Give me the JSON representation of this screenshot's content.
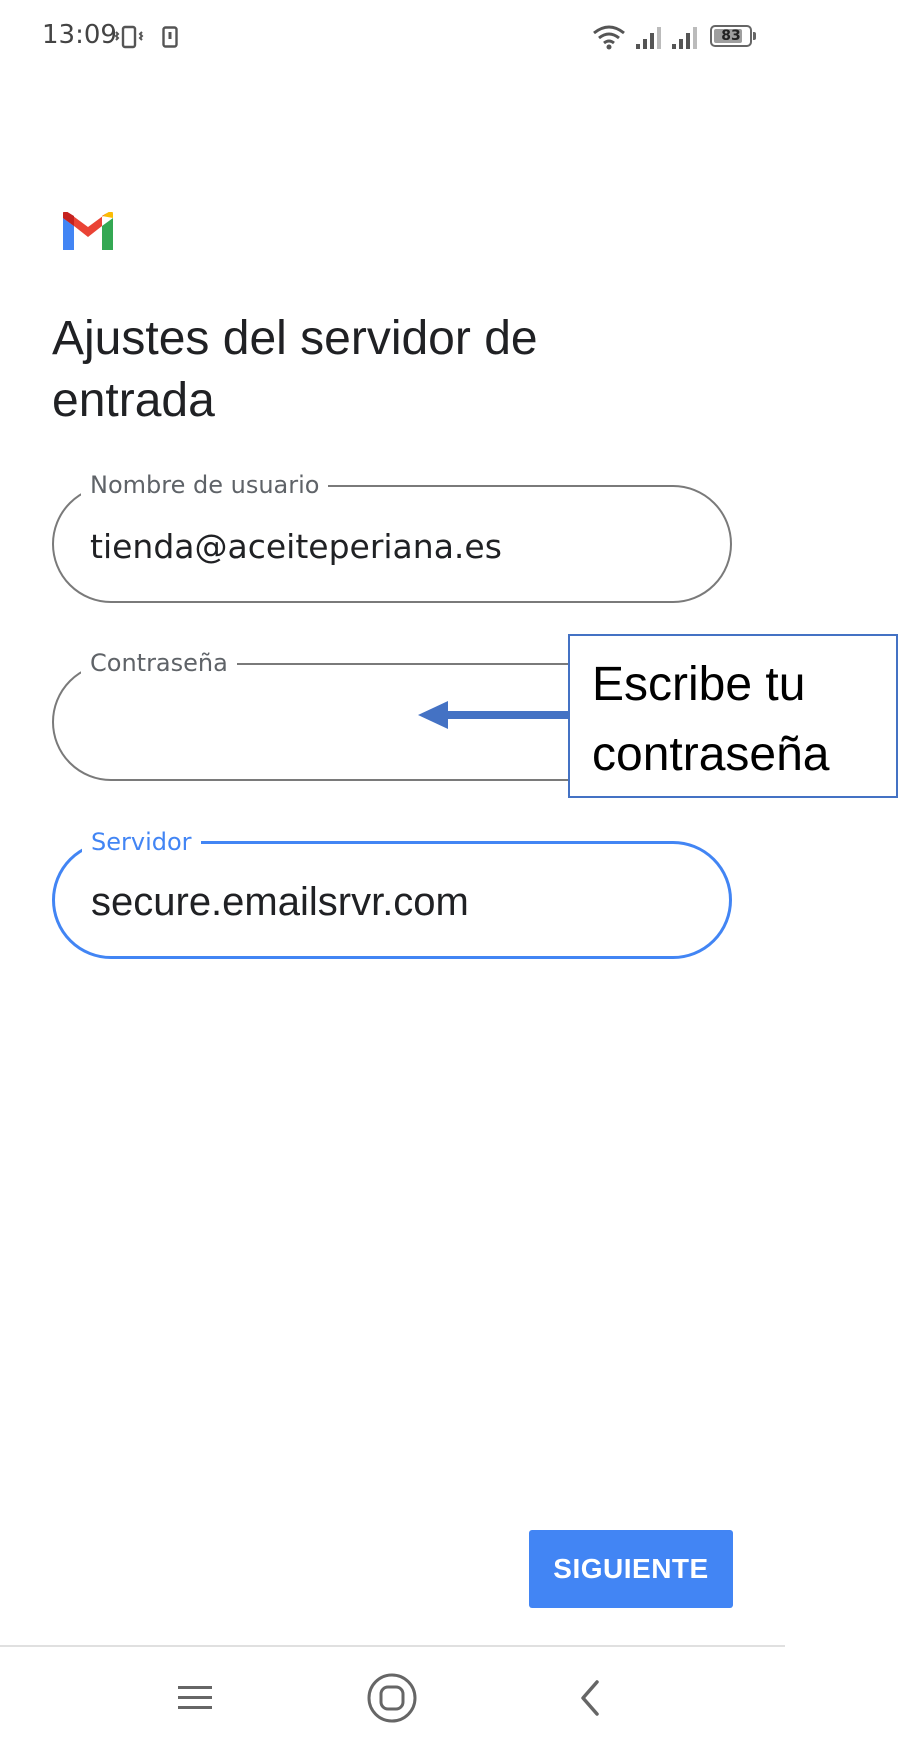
{
  "status_bar": {
    "time": "13:09",
    "battery_level": "83",
    "battery_fraction": 0.83,
    "icons": [
      "vibrate-icon",
      "sim-icon",
      "wifi-icon",
      "signal-icon",
      "signal-icon",
      "battery-icon"
    ]
  },
  "app": {
    "logo": "gmail-logo-icon"
  },
  "page": {
    "title": "Ajustes del servidor de entrada"
  },
  "fields": {
    "username": {
      "label": "Nombre de usuario",
      "value": "tienda@aceiteperiana.es"
    },
    "password": {
      "label": "Contraseña",
      "value": ""
    },
    "server": {
      "label": "Servidor",
      "value": "secure.emailsrvr.com"
    }
  },
  "annotation": {
    "text": "Escribe tu contraseña"
  },
  "actions": {
    "next_label": "SIGUIENTE"
  },
  "nav_bar": {
    "icons": [
      "menu-icon",
      "home-icon",
      "back-icon"
    ]
  },
  "colors": {
    "accent": "#4285f4",
    "callout": "#4472c4"
  }
}
